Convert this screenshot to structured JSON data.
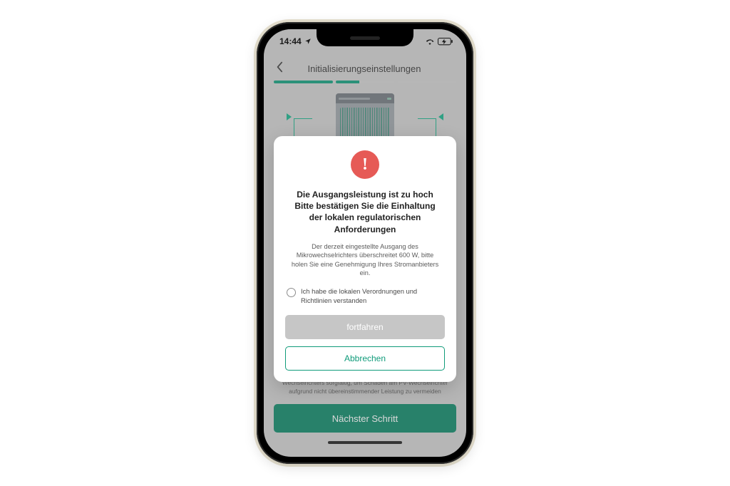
{
  "statusbar": {
    "time": "14:44"
  },
  "nav": {
    "title": "Initialisierungseinstellungen"
  },
  "background": {
    "warning_text": "Bitte prüfen Sie unbedingt das Parameter-Typenschild des PV-Wechselrichters sorgfältig, um Schäden am PV-Wechselrichter aufgrund nicht übereinstimmender Leistung zu vermeiden",
    "next_button": "Nächster Schritt"
  },
  "dialog": {
    "title": "Die Ausgangsleistung ist zu hoch\nBitte bestätigen Sie die Einhaltung der lokalen regulatorischen Anforderungen",
    "body": "Der derzeit eingestellte Ausgang des Mikrowechselrichters überschreitet 600 W, bitte holen Sie eine Genehmigung Ihres Stromanbieters ein.",
    "checkbox_label": "Ich habe die lokalen Verordnungen und Richtlinien verstanden",
    "continue_label": "fortfahren",
    "cancel_label": "Abbrechen"
  }
}
